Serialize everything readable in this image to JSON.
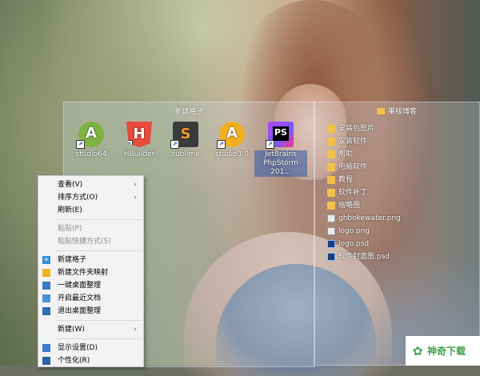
{
  "fence1": {
    "title": "新建格子",
    "icons": [
      {
        "label": "studio64",
        "icon": "android-studio-icon"
      },
      {
        "label": "HBuilder",
        "icon": "hbuilder-icon"
      },
      {
        "label": "sublime",
        "icon": "sublime-icon"
      },
      {
        "label": "studio3.0",
        "icon": "android-studio-icon"
      },
      {
        "label": "JetBrains PhpStorm 201...",
        "icon": "phpstorm-icon"
      }
    ]
  },
  "fence2": {
    "title": "果核博客",
    "items": [
      {
        "label": "安装包图片",
        "type": "folder"
      },
      {
        "label": "安装软件",
        "type": "folder"
      },
      {
        "label": "帮助",
        "type": "folder"
      },
      {
        "label": "电脑软件",
        "type": "folder"
      },
      {
        "label": "教程",
        "type": "folder"
      },
      {
        "label": "软件补丁",
        "type": "folder"
      },
      {
        "label": "缩略图",
        "type": "folder"
      },
      {
        "label": "ghbokewater.png",
        "type": "png"
      },
      {
        "label": "logo.png",
        "type": "png"
      },
      {
        "label": "logo.psd",
        "type": "psd"
      },
      {
        "label": "软件封面图.psd",
        "type": "psd"
      }
    ]
  },
  "context_menu": {
    "view": "查看(V)",
    "sort": "排序方式(O)",
    "refresh": "刷新(E)",
    "paste": "粘贴(P)",
    "paste_shortcut": "粘贴快捷方式(S)",
    "new_fence": "新建格子",
    "new_folder_map": "新建文件夹映射",
    "one_click_organize": "一键桌面整理",
    "recent_docs": "开启最近文档",
    "exit_organize": "退出桌面整理",
    "new": "新建(W)",
    "display_settings": "显示设置(D)",
    "personalize": "个性化(R)",
    "submenu_arrow": "›"
  },
  "watermark": {
    "text": "神奇下载"
  }
}
